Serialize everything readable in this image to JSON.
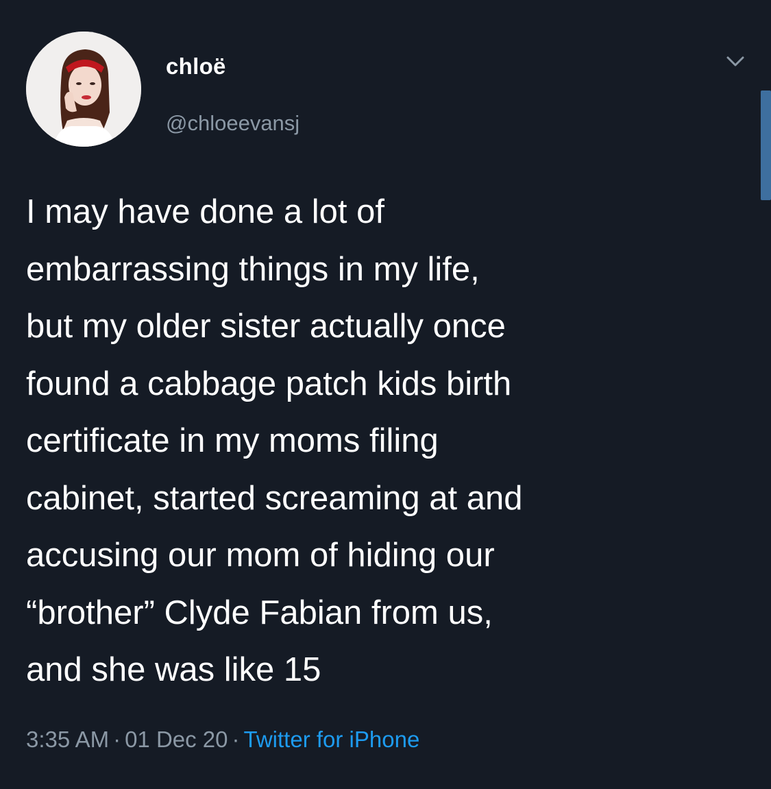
{
  "user": {
    "display_name": "chloë",
    "handle": "@chloeevansj",
    "avatar_icon": "profile-photo-icon"
  },
  "tweet": {
    "lines": [
      "I may have done a lot of",
      "embarrassing things in my life,",
      "but my older sister actually once",
      "found a cabbage patch kids birth",
      "certificate in my moms filing",
      "cabinet, started screaming at and",
      "accusing our mom of hiding our",
      "“brother” Clyde Fabian from us,",
      "and she was like 15"
    ],
    "time": "3:35 AM",
    "date": "01 Dec 20",
    "source": "Twitter for iPhone",
    "separator": "·"
  },
  "controls": {
    "more_icon": "chevron-down-icon"
  },
  "colors": {
    "background": "#151b25",
    "text": "#ffffff",
    "muted": "#8b98a5",
    "link": "#1d9bf0",
    "scrollbar": "#3e6f9f"
  }
}
